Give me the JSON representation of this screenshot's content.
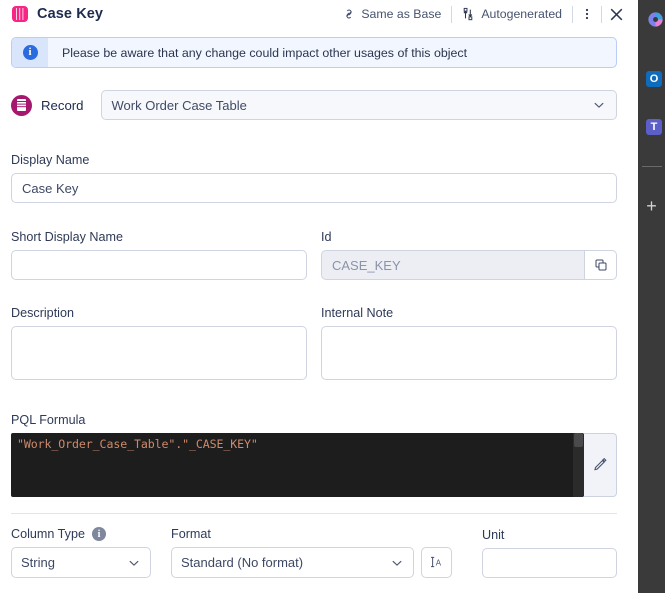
{
  "header": {
    "icon": "column-table-icon",
    "title": "Case Key",
    "chips": [
      {
        "icon": "link-break-icon",
        "label": "Same as Base"
      },
      {
        "icon": "autogenerated-icon",
        "label": "Autogenerated"
      }
    ],
    "more_icon": "more-vertical-icon",
    "close_icon": "close-icon"
  },
  "banner": {
    "icon": "info-circle-icon",
    "message": "Please be aware that any change could impact other usages of this object",
    "accent": "#2b6be0",
    "background": "#f2f7ff",
    "border": "#b9cdf5"
  },
  "record": {
    "icon": "record-table-icon",
    "label": "Record",
    "selected": "Work Order Case Table",
    "chevron": "chevron-down-icon",
    "accent": "#a6186e"
  },
  "fields": {
    "display_name": {
      "label": "Display Name",
      "value": "Case Key",
      "placeholder": ""
    },
    "short_display_name": {
      "label": "Short Display Name",
      "value": "",
      "placeholder": ""
    },
    "id": {
      "label": "Id",
      "value": "CASE_KEY",
      "disabled": true,
      "copy_icon": "copy-icon"
    },
    "description": {
      "label": "Description",
      "value": "",
      "placeholder": ""
    },
    "internal_note": {
      "label": "Internal Note",
      "value": "",
      "placeholder": ""
    }
  },
  "pql": {
    "label": "PQL Formula",
    "code": "\"Work_Order_Case_Table\".\"_CASE_KEY\"",
    "code_color": "#ce8a6a",
    "editor_background": "#1d1d1d",
    "edit_icon": "pencil-icon"
  },
  "bottom": {
    "column_type": {
      "label": "Column Type",
      "info_icon": "info-circle-grey-icon",
      "value": "String",
      "chevron": "chevron-down-icon"
    },
    "format": {
      "label": "Format",
      "value": "Standard (No format)",
      "chevron": "chevron-down-icon"
    },
    "text_format_button": {
      "icon": "text-cursor-a-icon",
      "label": "A"
    },
    "unit": {
      "label": "Unit",
      "value": "",
      "placeholder": ""
    }
  },
  "taskbar": {
    "background": "#3a3a3a",
    "items": [
      {
        "name": "powerbi-icon",
        "label": ""
      },
      {
        "name": "outlook-icon",
        "label": "O"
      },
      {
        "name": "teams-icon",
        "label": "T"
      }
    ],
    "add_label": "+"
  }
}
